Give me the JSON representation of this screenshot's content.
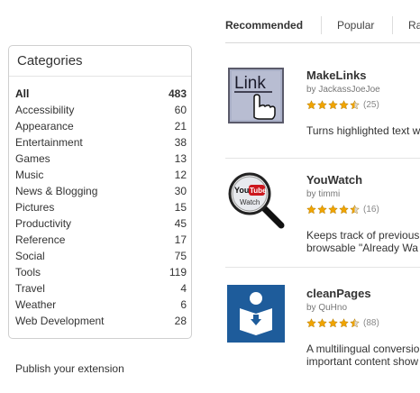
{
  "tabs": [
    "Recommended",
    "Popular",
    "Ra"
  ],
  "categories": {
    "title": "Categories",
    "items": [
      {
        "label": "All",
        "count": "483"
      },
      {
        "label": "Accessibility",
        "count": "60"
      },
      {
        "label": "Appearance",
        "count": "21"
      },
      {
        "label": "Entertainment",
        "count": "38"
      },
      {
        "label": "Games",
        "count": "13"
      },
      {
        "label": "Music",
        "count": "12"
      },
      {
        "label": "News & Blogging",
        "count": "30"
      },
      {
        "label": "Pictures",
        "count": "15"
      },
      {
        "label": "Productivity",
        "count": "45"
      },
      {
        "label": "Reference",
        "count": "17"
      },
      {
        "label": "Social",
        "count": "75"
      },
      {
        "label": "Tools",
        "count": "119"
      },
      {
        "label": "Travel",
        "count": "4"
      },
      {
        "label": "Weather",
        "count": "6"
      },
      {
        "label": "Web Development",
        "count": "28"
      }
    ]
  },
  "bottom_link": "Publish your extension",
  "extensions": [
    {
      "name": "MakeLinks",
      "author": "by JackassJoeJoe",
      "rating": 4.5,
      "rating_count": "(25)",
      "description": [
        "Turns highlighted text w"
      ],
      "icon": "link-cursor-icon",
      "icon_text": "Link"
    },
    {
      "name": "YouWatch",
      "author": "by timmi",
      "rating": 4.5,
      "rating_count": "(16)",
      "description": [
        "Keeps track of previous",
        "browsable \"Already Wa"
      ],
      "icon": "youtube-magnifier-icon",
      "icon_text": [
        "You",
        "Tube",
        "Watch"
      ]
    },
    {
      "name": "cleanPages",
      "author": "by QuHno",
      "rating": 4.5,
      "rating_count": "(88)",
      "description": [
        "A multilingual conversio",
        "important content show"
      ],
      "icon": "reader-book-icon"
    }
  ],
  "colors": {
    "star": "#f0a400",
    "makelinks_bg": "#aab0c8",
    "youtube_red": "#cc181e",
    "cleanpages_bg": "#1e5c9b"
  }
}
